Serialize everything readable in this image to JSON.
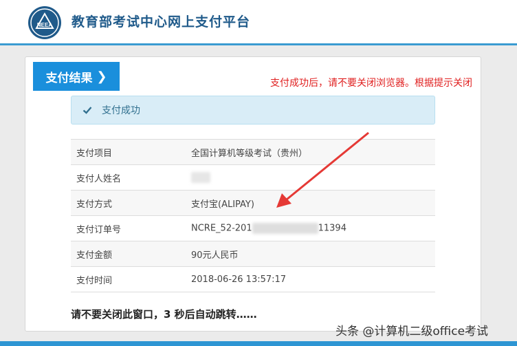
{
  "header": {
    "title": "教育部考试中心网上支付平台",
    "logo_text": "NEEA",
    "logo_icon": "neea-logo-icon"
  },
  "result_button": {
    "label": "支付结果",
    "icon": "chevron-right-icon"
  },
  "annotation_note": "支付成功后，请不要关闭浏览器。根据提示关闭",
  "success_alert": {
    "icon": "check-icon",
    "text": "支付成功"
  },
  "payment_info": {
    "rows": [
      {
        "label": "支付项目",
        "value": "全国计算机等级考试（贵州）"
      },
      {
        "label": "支付人姓名",
        "value": ""
      },
      {
        "label": "支付方式",
        "value": "支付宝(ALIPAY)"
      },
      {
        "label": "支付订单号",
        "value_visible_start": "NCRE_52-201",
        "value_visible_end": "11394"
      },
      {
        "label": "支付金额",
        "value": "90元人民币"
      },
      {
        "label": "支付时间",
        "value": "2018-06-26 13:57:17"
      }
    ]
  },
  "countdown_text": "请不要关闭此窗口，3 秒后自动跳转……",
  "watermark": "头条 @计算机二级office考试",
  "colors": {
    "header_border": "#3a9bd1",
    "button_bg": "#1a8fdc",
    "alert_bg": "#d9edf7",
    "alert_text": "#31708f",
    "note_red": "#e02020",
    "arrow_red": "#e53935",
    "footer": "#2e95d3"
  }
}
